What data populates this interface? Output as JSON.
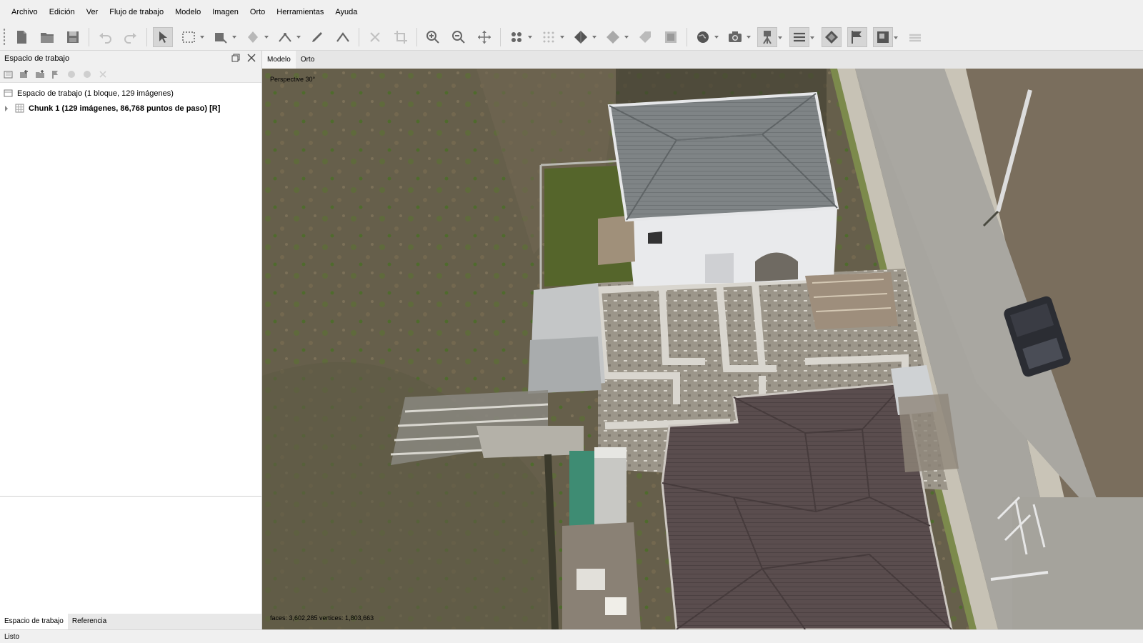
{
  "menu": [
    "Archivo",
    "Edición",
    "Ver",
    "Flujo de trabajo",
    "Modelo",
    "Imagen",
    "Orto",
    "Herramientas",
    "Ayuda"
  ],
  "workspace_panel": {
    "title": "Espacio de trabajo",
    "tree": {
      "root": "Espacio de trabajo (1 bloque, 129 imágenes)",
      "chunk": "Chunk 1 (129 imágenes, 86,768 puntos de paso) [R]"
    },
    "tabs": [
      "Espacio de trabajo",
      "Referencia"
    ]
  },
  "view_tabs": [
    "Modelo",
    "Orto"
  ],
  "viewport": {
    "projection_label": "Perspective 30°",
    "stats_label": "faces: 3,602,285 vertices: 1,803,663"
  },
  "status": "Listo",
  "colors": {
    "panel_bg": "#f0f0f0",
    "active_tab": "#f5f5f5",
    "roof_gray": "#7f8486",
    "roof_brown": "#5a4d4e",
    "ground": "#6b6450",
    "road": "#a7a59f"
  }
}
